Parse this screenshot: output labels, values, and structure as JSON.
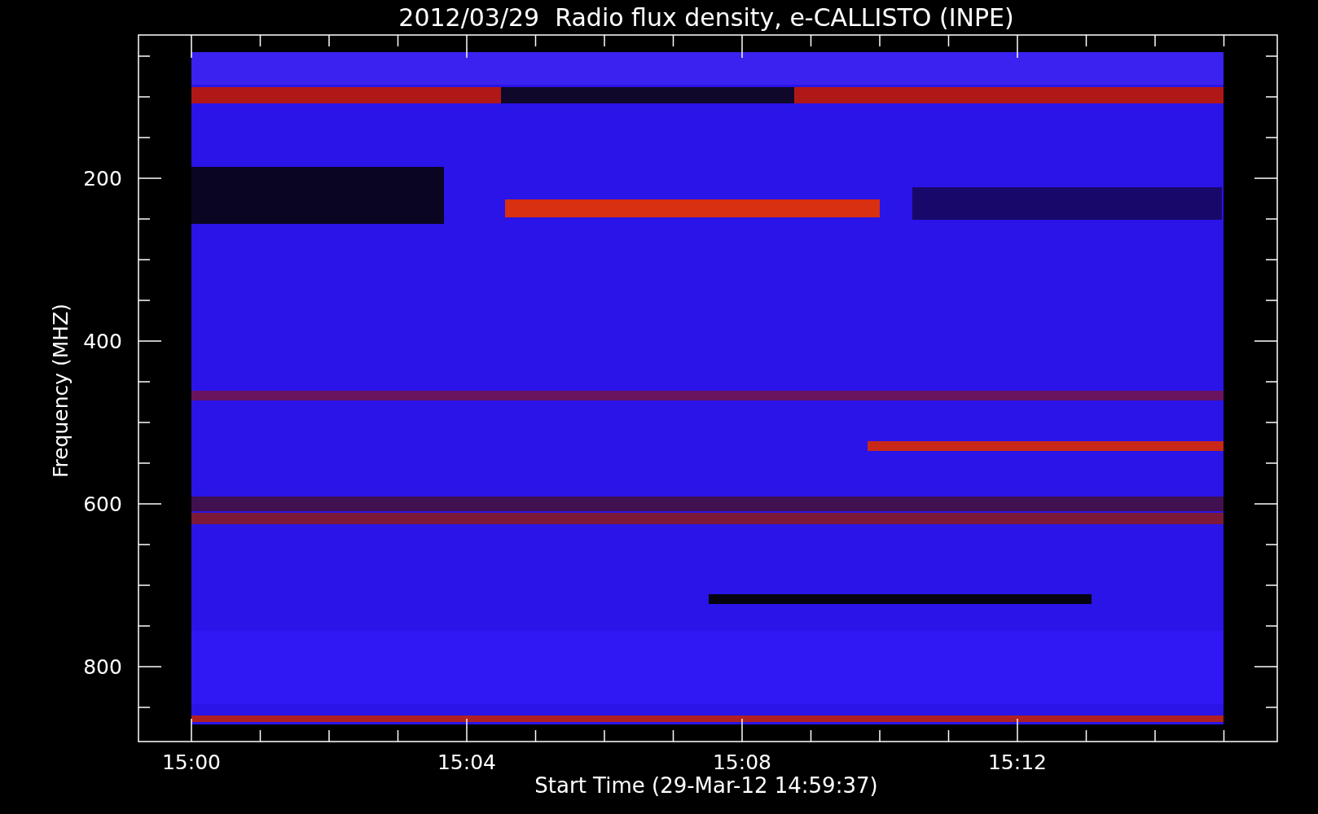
{
  "title": "2012/03/29  Radio flux density, e-CALLISTO (INPE)",
  "y_axis": {
    "label": "Frequency (MHZ)",
    "ticks": [
      "200",
      "400",
      "600",
      "800"
    ]
  },
  "x_axis": {
    "label": "Start Time (29-Mar-12 14:59:37)",
    "ticks": [
      "15:00",
      "15:04",
      "15:08",
      "15:12"
    ]
  }
}
